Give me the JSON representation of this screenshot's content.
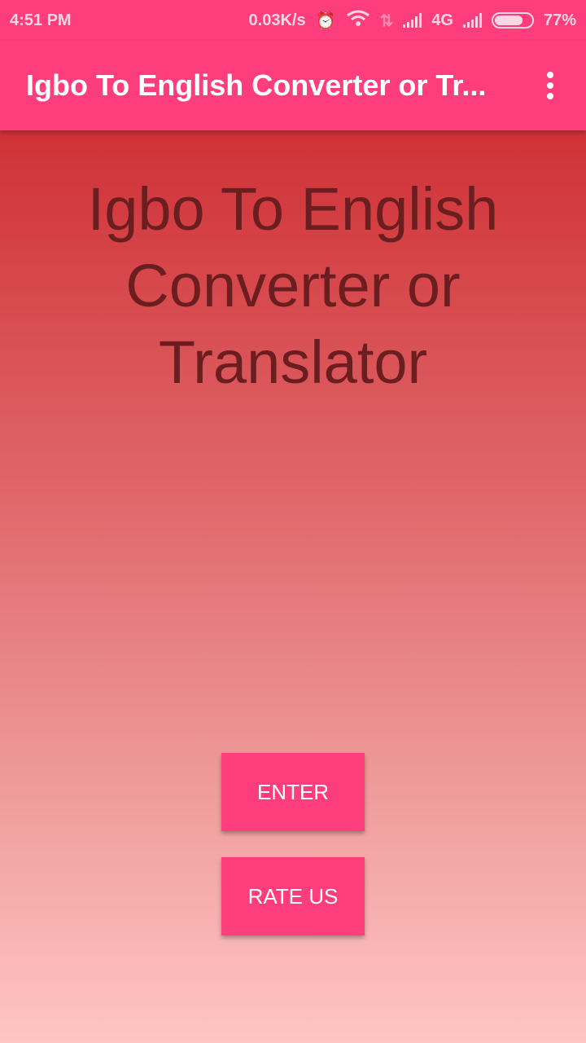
{
  "status_bar": {
    "time": "4:51 PM",
    "net_speed": "0.03K/s",
    "network_type": "4G",
    "battery_percent": "77%",
    "battery_level": 0.77,
    "icons": [
      "alarm-icon",
      "wifi-icon",
      "data-activity-icon",
      "signal-icon",
      "signal-icon",
      "battery-icon"
    ]
  },
  "app_bar": {
    "title": "Igbo To English Converter or Tr..."
  },
  "main": {
    "headline": "Igbo To English Converter or Translator",
    "enter_label": "ENTER",
    "rate_label": "RATE US"
  },
  "colors": {
    "accent": "#fe3e7c",
    "headline": "#6b1e1f",
    "gradient_top": "#cf3136",
    "gradient_bottom": "#ffc5c3"
  }
}
